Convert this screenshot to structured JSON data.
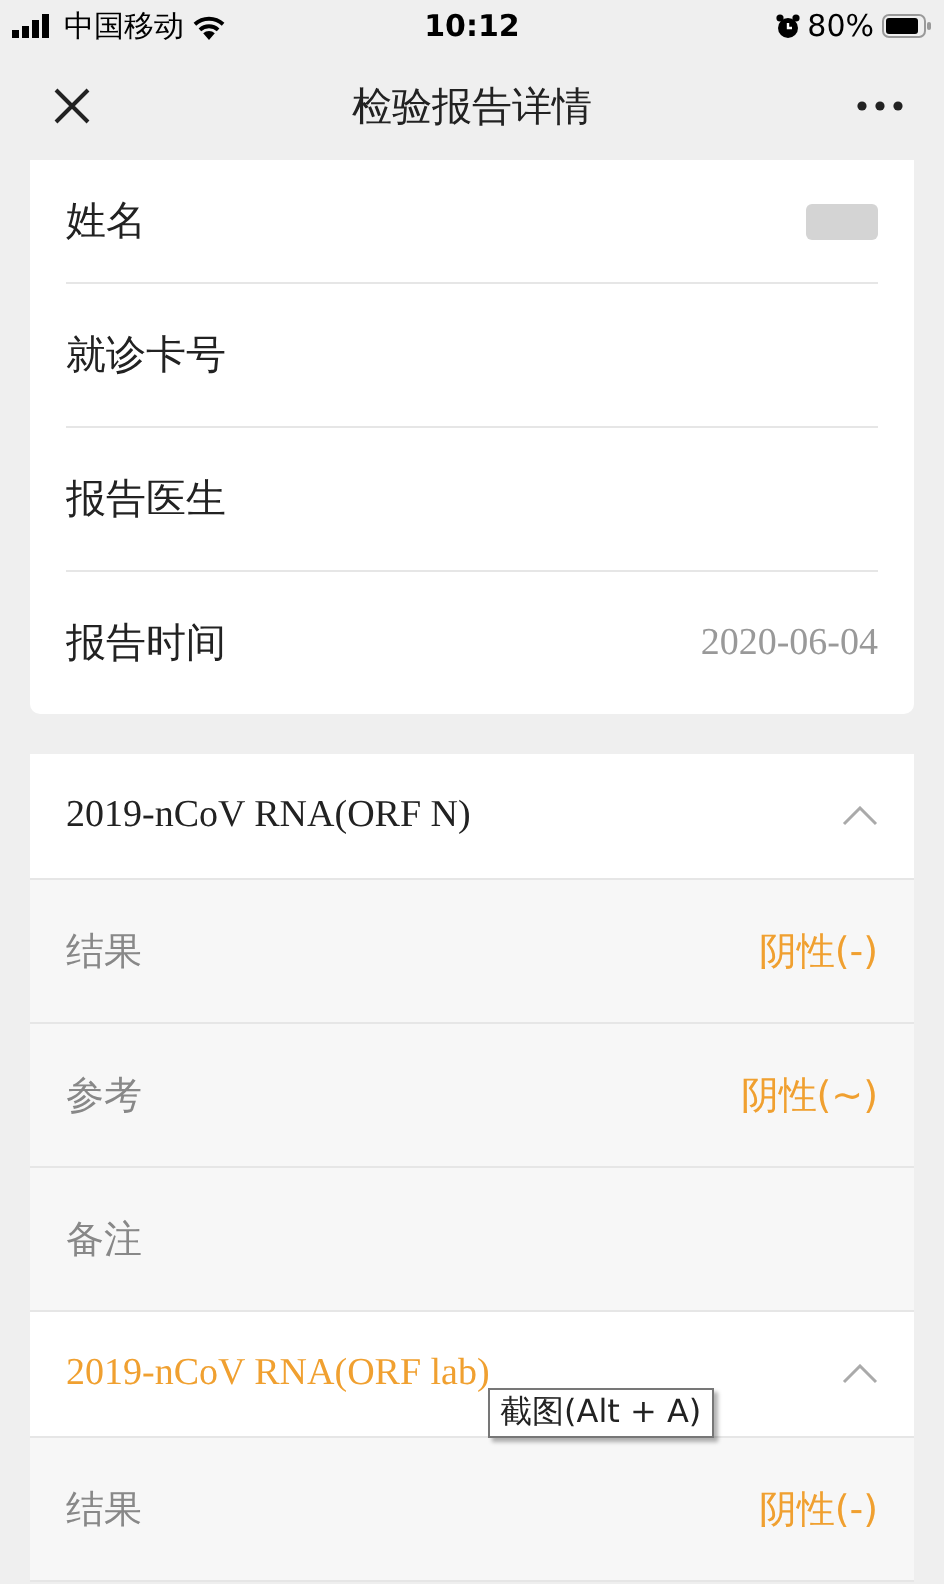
{
  "status_bar": {
    "carrier": "中国移动",
    "time": "10:12",
    "battery": "80%"
  },
  "nav": {
    "title": "检验报告详情"
  },
  "patient_fields": [
    {
      "label": "姓名",
      "redacted": true
    },
    {
      "label": "就诊卡号"
    },
    {
      "label": "报告医生"
    },
    {
      "label": "报告时间",
      "value": "2020-06-04"
    }
  ],
  "tests": [
    {
      "name": "2019-nCoV RNA(ORF N)",
      "selected": false,
      "expanded": true,
      "rows": [
        {
          "label": "结果",
          "value": "阴性(-)"
        },
        {
          "label": "参考",
          "value": "阴性(~)"
        },
        {
          "label": "备注"
        }
      ]
    },
    {
      "name": "2019-nCoV RNA(ORF lab)",
      "selected": true,
      "expanded": true,
      "rows": [
        {
          "label": "结果",
          "value": "阴性(-)"
        }
      ]
    }
  ],
  "tooltip": "截图(Alt + A)"
}
